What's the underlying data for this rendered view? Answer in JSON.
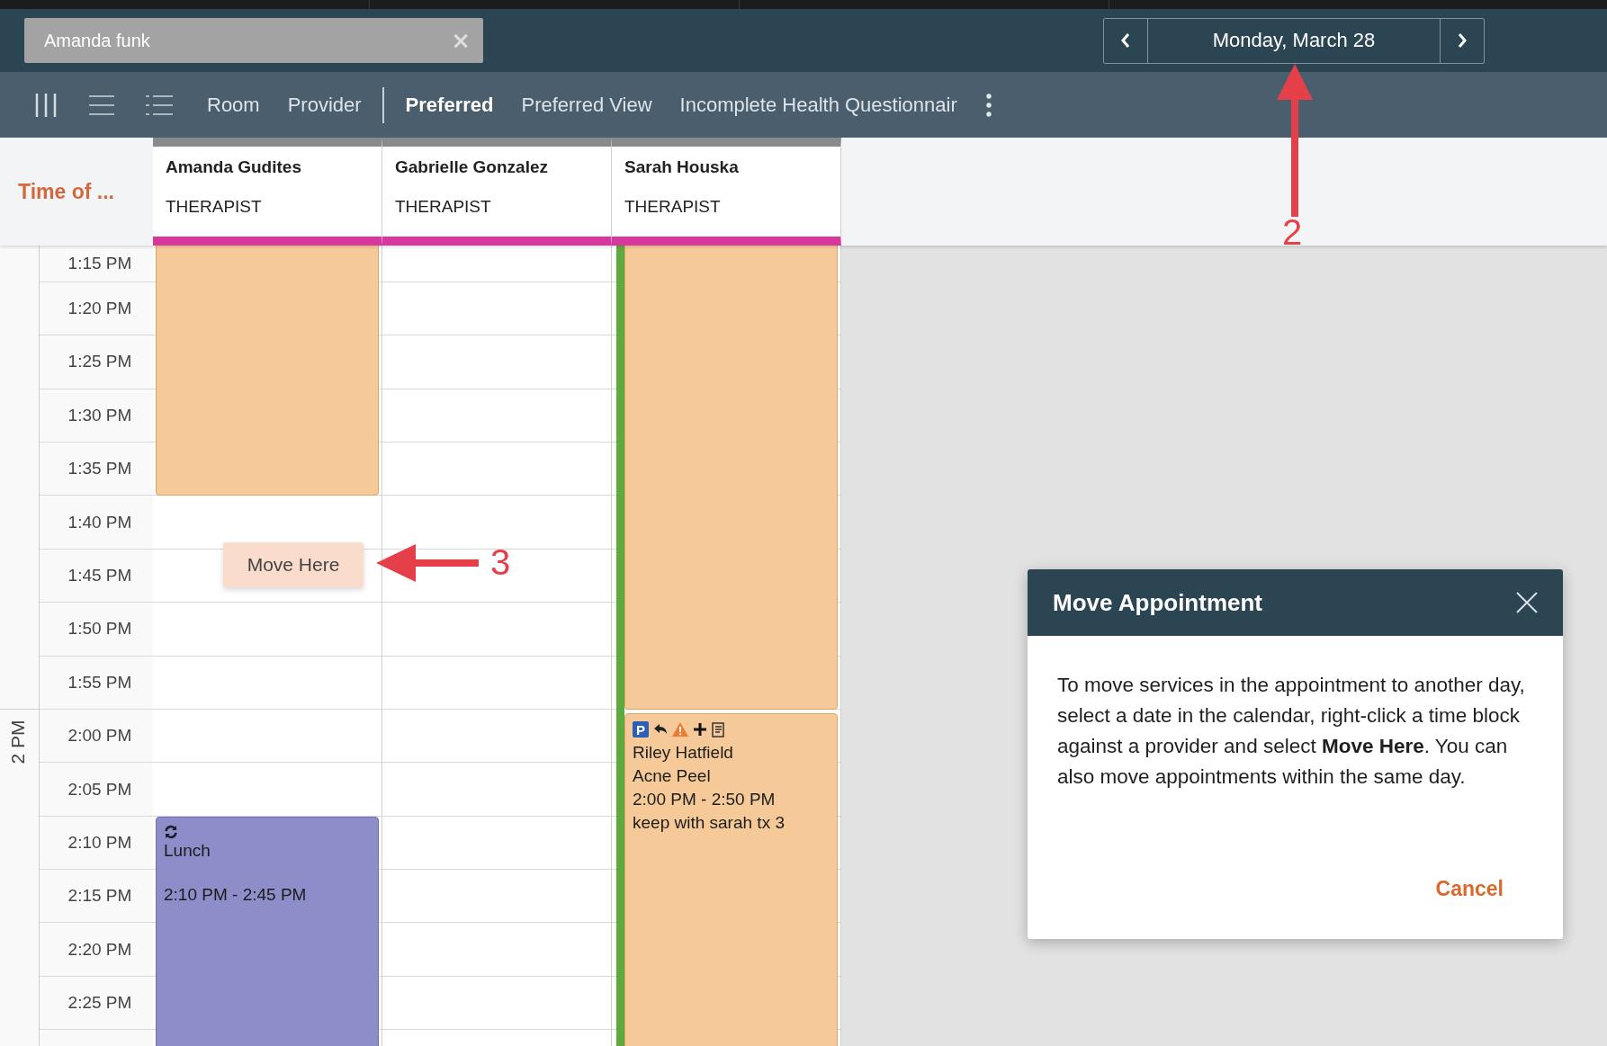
{
  "search": {
    "placeholder": "Amanda funk",
    "clear": "×"
  },
  "date_nav": {
    "date": "Monday, March 28"
  },
  "toolbar": {
    "groupings": [
      {
        "label": "Room",
        "selected": false
      },
      {
        "label": "Provider",
        "selected": false
      }
    ],
    "views": [
      {
        "label": "Preferred",
        "selected": true
      },
      {
        "label": "Preferred View",
        "selected": false
      },
      {
        "label": "Incomplete Health Questionnair",
        "selected": false
      }
    ]
  },
  "calendar": {
    "time_header": "Time of ...",
    "hour_label": "2 PM",
    "time_slots": [
      "1:15 PM",
      "1:20 PM",
      "1:25 PM",
      "1:30 PM",
      "1:35 PM",
      "1:40 PM",
      "1:45 PM",
      "1:50 PM",
      "1:55 PM",
      "2:00 PM",
      "2:05 PM",
      "2:10 PM",
      "2:15 PM",
      "2:20 PM",
      "2:25 PM"
    ],
    "providers": [
      {
        "name": "Amanda Gudites",
        "role": "THERAPIST",
        "highlighted": false,
        "appointments": [
          {
            "kind": "block"
          },
          {
            "kind": "break",
            "title": "Lunch",
            "time": "2:10 PM - 2:45 PM",
            "recurring": true
          }
        ]
      },
      {
        "name": "Gabrielle Gonzalez",
        "role": "THERAPIST",
        "highlighted": false
      },
      {
        "name": "Sarah Houska",
        "role": "THERAPIST",
        "highlighted": true,
        "appointments": [
          {
            "kind": "block"
          },
          {
            "kind": "booking",
            "badge": "P",
            "client": "Riley Hatfield",
            "service": "Acne Peel",
            "time": "2:00 PM - 2:50 PM",
            "note": "keep with sarah tx 3"
          }
        ]
      }
    ]
  },
  "context_menu": {
    "item": "Move Here"
  },
  "annotations": [
    {
      "label": "2"
    },
    {
      "label": "3"
    }
  ],
  "dialog": {
    "title": "Move Appointment",
    "body": "To move services in the appointment to another day, select a date in the calendar, right-click a time block against a provider and select **Move Here**. You can also move appointments within the same day.",
    "cancel": "Cancel"
  }
}
